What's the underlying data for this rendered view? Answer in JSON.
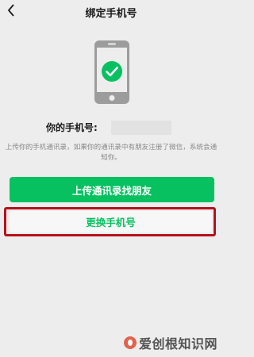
{
  "nav": {
    "back_icon": "chevron-left-icon",
    "title": "绑定手机号"
  },
  "illustration": {
    "icon": "phone-with-check-icon",
    "phone_color": "#9c9c9c",
    "check_color": "#07c160"
  },
  "phone": {
    "label": "你的手机号:",
    "value_masked": ""
  },
  "description": "上传你的手机通讯录，如果你的通讯录中有朋友注册了微信，系统会通知你。",
  "buttons": {
    "upload_contacts": "上传通讯录找朋友",
    "change_phone": "更换手机号"
  },
  "colors": {
    "accent": "#07c160",
    "highlight": "#b5121b",
    "background": "#ededed"
  },
  "watermark": {
    "text": "爱创根知识网"
  }
}
